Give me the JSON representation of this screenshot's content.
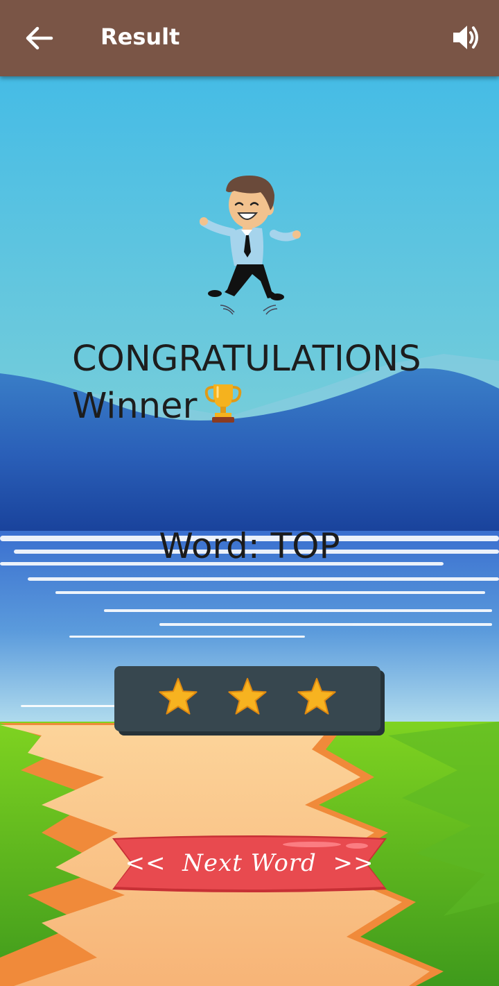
{
  "appbar": {
    "title": "Result",
    "back_icon": "arrow-left-icon",
    "sound_icon": "volume-icon",
    "background_color": "#7a5546"
  },
  "result": {
    "heading": "CONGRATULATIONS",
    "subheading": "Winner",
    "trophy_icon": "trophy-icon",
    "word_line": "Word: TOP"
  },
  "rating": {
    "stars_earned": 3,
    "stars_total": 3,
    "star_color": "#f7b320",
    "panel_color": "#37474f"
  },
  "next_button": {
    "label": "Next Word",
    "left_arrows": "<<",
    "right_arrows": ">>",
    "color": "#e84a4f"
  }
}
